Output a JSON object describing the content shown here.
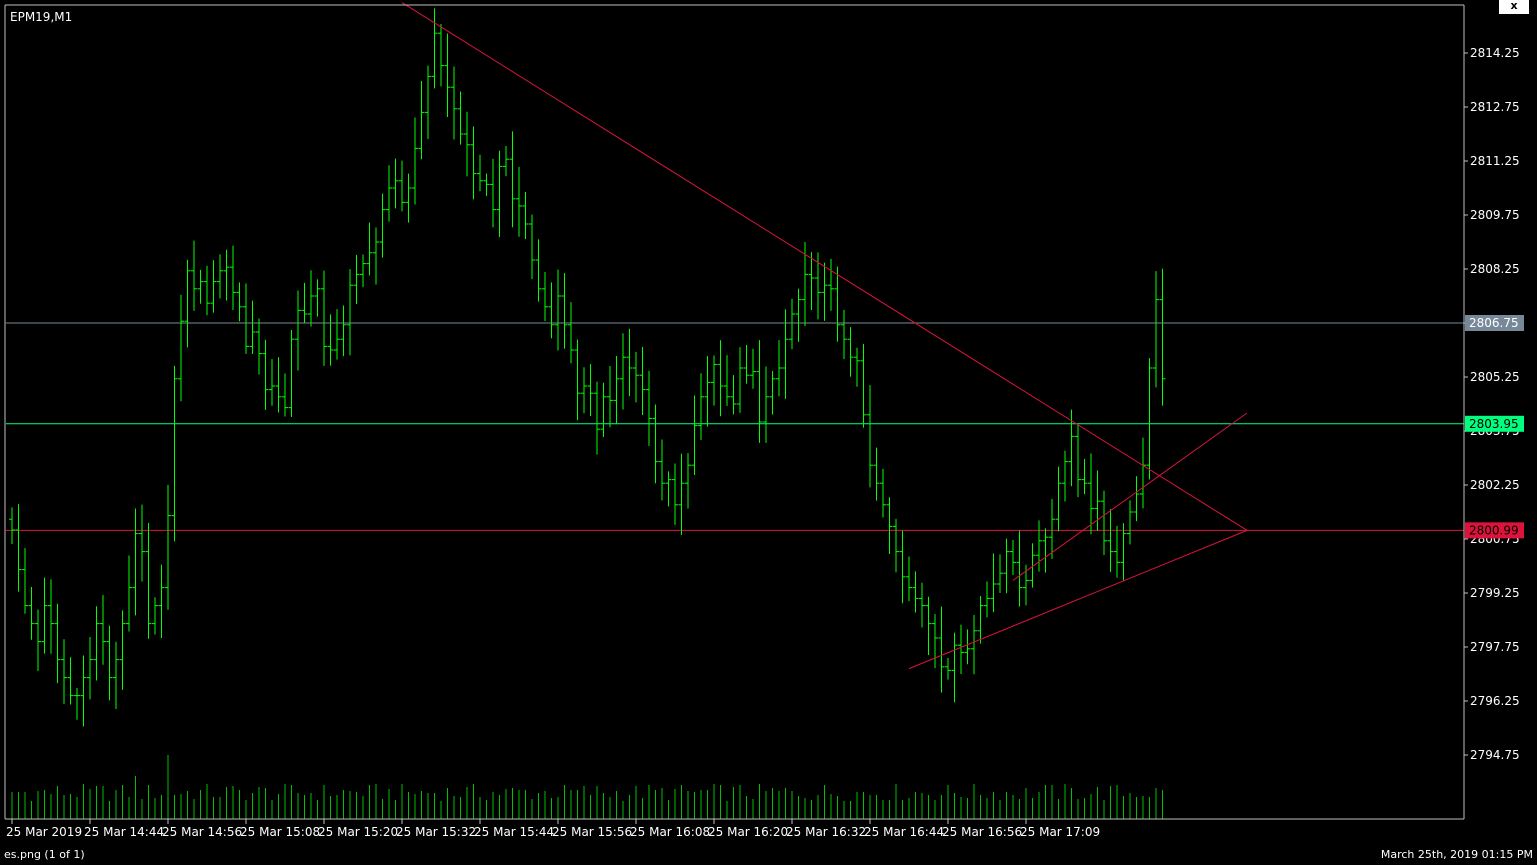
{
  "window": {
    "symbol_label": "EPM19,M1",
    "close_label": "x",
    "status_left": "es.png (1 of 1)",
    "status_right": "March 25th, 2019 01:15 PM"
  },
  "colors": {
    "background": "#000000",
    "frame": "#c0c0c0",
    "bar": "#00ff00",
    "volume": "#00c000",
    "trendline": "#dc143c",
    "level_gray": "#778899",
    "level_green": "#00ff7f",
    "level_red": "#dc143c"
  },
  "chart_data": {
    "type": "ohlc",
    "ylim": [
      2793.5,
      2816.0
    ],
    "y_ticks": [
      "2814.25",
      "2812.75",
      "2811.25",
      "2809.75",
      "2808.25",
      "2806.75",
      "2805.25",
      "2803.75",
      "2802.25",
      "2800.75",
      "2799.25",
      "2797.75",
      "2796.25",
      "2794.75"
    ],
    "x_tick_labels": [
      "25 Mar 2019",
      "25 Mar 14:44",
      "25 Mar 14:56",
      "25 Mar 15:08",
      "25 Mar 15:20",
      "25 Mar 15:32",
      "25 Mar 15:44",
      "25 Mar 15:56",
      "25 Mar 16:08",
      "25 Mar 16:20",
      "25 Mar 16:32",
      "25 Mar 16:44",
      "25 Mar 16:56",
      "25 Mar 17:09"
    ],
    "x_tick_bar_index": [
      0,
      12,
      24,
      36,
      48,
      60,
      72,
      84,
      96,
      108,
      120,
      132,
      144,
      156
    ],
    "closes": [
      2801.0,
      2799.9,
      2798.9,
      2798.4,
      2797.9,
      2798.9,
      2798.4,
      2797.4,
      2796.9,
      2796.4,
      2796.4,
      2796.9,
      2797.4,
      2798.4,
      2797.9,
      2796.9,
      2797.4,
      2798.4,
      2799.4,
      2800.9,
      2800.4,
      2798.4,
      2798.9,
      2799.4,
      2801.4,
      2805.2,
      2806.8,
      2808.2,
      2807.7,
      2807.9,
      2807.3,
      2807.9,
      2808.2,
      2808.3,
      2807.6,
      2807.2,
      2806.1,
      2806.5,
      2805.9,
      2804.9,
      2805.0,
      2804.7,
      2804.4,
      2806.3,
      2807.1,
      2807.0,
      2807.5,
      2807.7,
      2806.1,
      2806.0,
      2806.3,
      2806.7,
      2807.8,
      2808.1,
      2808.4,
      2808.7,
      2809.0,
      2809.9,
      2810.5,
      2810.7,
      2810.1,
      2810.5,
      2811.6,
      2812.6,
      2813.6,
      2814.8,
      2813.9,
      2813.3,
      2812.7,
      2812.0,
      2811.7,
      2810.9,
      2810.7,
      2810.6,
      2809.9,
      2811.1,
      2811.3,
      2810.2,
      2810.0,
      2809.5,
      2808.5,
      2807.7,
      2807.2,
      2806.7,
      2807.5,
      2806.7,
      2806.0,
      2804.8,
      2805.0,
      2804.8,
      2803.8,
      2804.7,
      2804.6,
      2805.2,
      2805.8,
      2805.5,
      2805.3,
      2804.9,
      2804.1,
      2802.9,
      2802.3,
      2802.4,
      2801.7,
      2802.3,
      2802.8,
      2803.9,
      2804.7,
      2805.1,
      2805.6,
      2805.0,
      2804.7,
      2804.5,
      2805.5,
      2805.3,
      2805.4,
      2804.0,
      2804.7,
      2805.2,
      2805.5,
      2806.3,
      2807.0,
      2807.4,
      2808.1,
      2808.0,
      2807.6,
      2807.8,
      2807.7,
      2806.7,
      2806.3,
      2805.8,
      2805.7,
      2804.2,
      2802.8,
      2802.3,
      2801.7,
      2801.1,
      2800.4,
      2799.7,
      2799.4,
      2799.1,
      2798.9,
      2798.4,
      2798.0,
      2797.2,
      2797.1,
      2797.8,
      2797.6,
      2797.7,
      2798.2,
      2798.9,
      2799.1,
      2799.5,
      2799.8,
      2800.4,
      2800.1,
      2799.4,
      2799.6,
      2800.3,
      2800.7,
      2800.8,
      2801.3,
      2802.3,
      2802.9,
      2803.6,
      2802.4,
      2802.3,
      2801.6,
      2801.8,
      2800.7,
      2800.4,
      2800.1,
      2800.9,
      2801.5,
      2802.0,
      2802.8,
      2805.5,
      2807.4,
      2805.2
    ],
    "levels": [
      {
        "label": "2806.75",
        "value": 2806.75,
        "color_key": "level_gray"
      },
      {
        "label": "2803.95",
        "value": 2803.95,
        "color_key": "level_green"
      },
      {
        "label": "2800.99",
        "value": 2800.99,
        "color_key": "level_red"
      }
    ],
    "trendlines": [
      {
        "from": [
          60,
          2815.65
        ],
        "to": [
          190,
          2800.99
        ]
      },
      {
        "from": [
          138,
          2797.15
        ],
        "to": [
          190,
          2800.99
        ]
      },
      {
        "from": [
          154,
          2799.6
        ],
        "to": [
          190,
          2804.25
        ]
      }
    ]
  }
}
